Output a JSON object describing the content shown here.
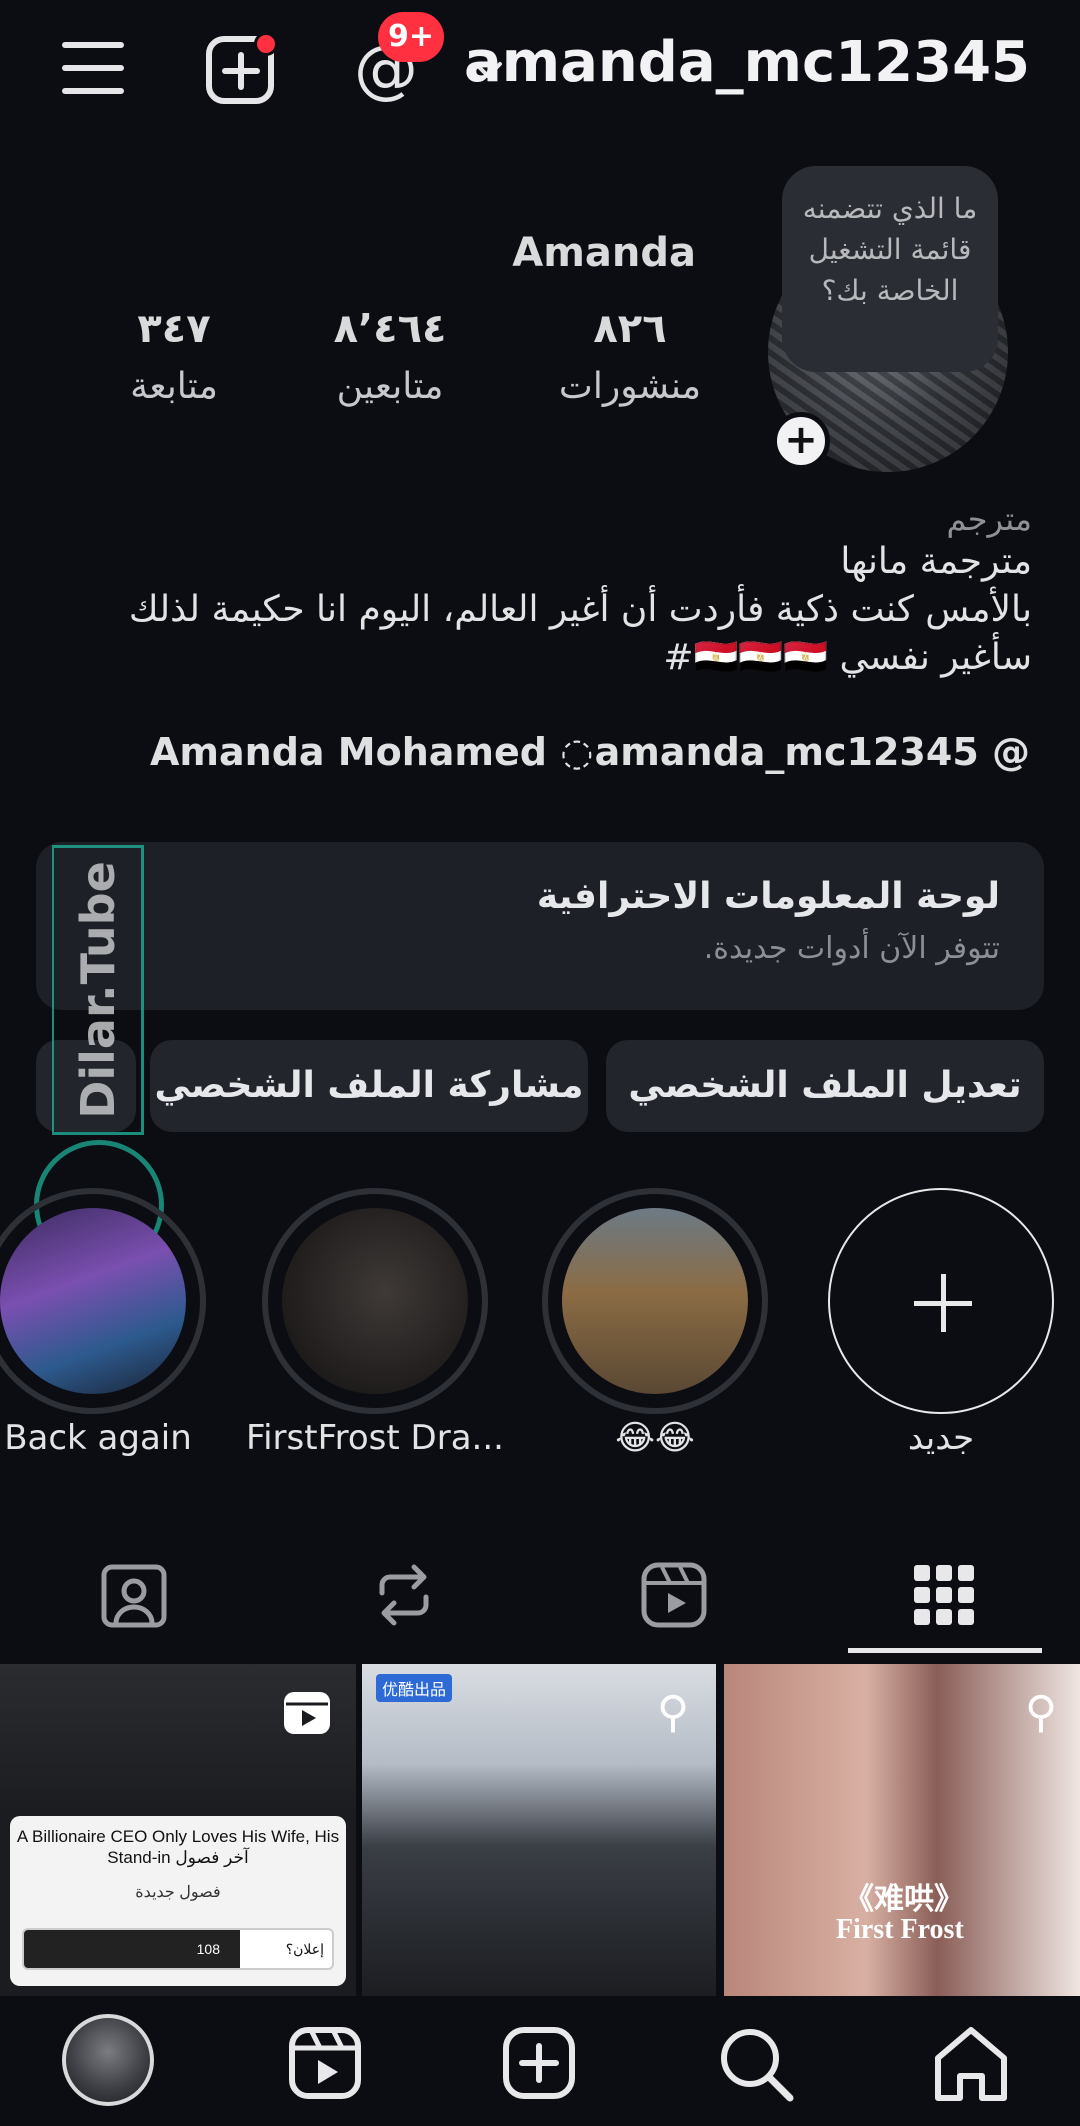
{
  "topbar": {
    "username": "amanda_mc12345",
    "threads_badge": "9+"
  },
  "profile": {
    "note": "ما الذي تتضمنه قائمة التشغيل الخاصة بك؟",
    "display_name": "Amanda",
    "stats": [
      {
        "num": "٨٢٦",
        "label": "منشورات"
      },
      {
        "num": "٨٬٤٦٤",
        "label": "متابعين"
      },
      {
        "num": "٣٤٧",
        "label": "متابعة"
      }
    ],
    "category": "مترجم",
    "bio_lines": [
      "مترجمة مانها",
      "بالأمس كنت ذكية فأردت أن أغير العالم، اليوم انا حكيمة لذلك",
      "سأغير نفسي 🇪🇬🇪🇬🇪🇬#"
    ],
    "threads_link": "amanda_mc12345",
    "fb_link": "Amanda Mohamed"
  },
  "dashboard": {
    "title": "لوحة المعلومات الاحترافية",
    "subtitle": "تتوفر الآن أدوات جديدة."
  },
  "buttons": {
    "edit": "تعديل الملف الشخصي",
    "share": "مشاركة الملف الشخصي"
  },
  "watermark": "Dilar.Tube",
  "highlights": [
    {
      "label": "جديد"
    },
    {
      "label": "😂😂"
    },
    {
      "label": "FirstFrost Dra..."
    },
    {
      "label": "Back again"
    }
  ],
  "grid": {
    "cell1": {
      "title": "A Billionaire CEO Only Loves His Wife, His Stand-in آخر فصول",
      "section": "فصول جديدة",
      "count": "108",
      "ad": "إعلان؟"
    },
    "cell2": {
      "tag": "优酷出品"
    },
    "cell3": {
      "cn": "《难哄》",
      "en": "First Frost"
    }
  },
  "icons": {
    "menu": "hamburger-icon",
    "create": "plus-square-icon",
    "threads": "threads-icon",
    "chevron": "chevron-down-icon",
    "tab_grid": "grid-icon",
    "tab_reels": "reels-icon",
    "tab_reposts": "repost-icon",
    "tab_tagged": "tagged-icon",
    "nav_home": "home-icon",
    "nav_search": "search-icon",
    "nav_create": "plus-square-icon",
    "nav_reels": "reels-icon"
  },
  "colors": {
    "background": "#0b0d12",
    "badge": "#ff3040",
    "watermark": "#1fae96"
  }
}
